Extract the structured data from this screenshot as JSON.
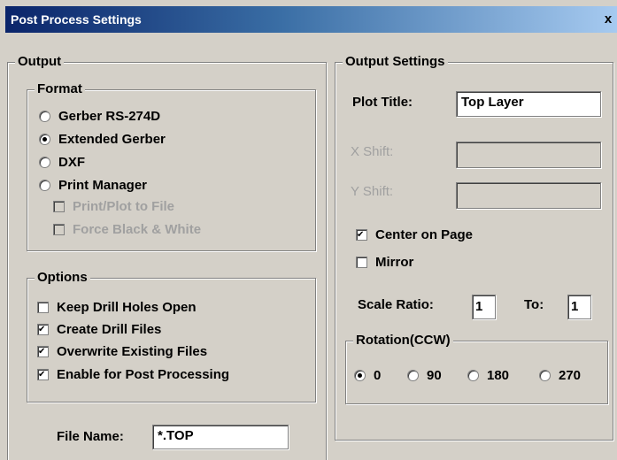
{
  "window": {
    "title": "Post Process Settings",
    "close_glyph": "x"
  },
  "output": {
    "group_label": "Output",
    "format": {
      "group_label": "Format",
      "options": [
        {
          "label": "Gerber RS-274D",
          "checked": false
        },
        {
          "label": "Extended Gerber",
          "checked": true
        },
        {
          "label": "DXF",
          "checked": false
        },
        {
          "label": "Print Manager",
          "checked": false
        }
      ],
      "sub_options": [
        {
          "label": "Print/Plot to File",
          "checked": false,
          "enabled": false
        },
        {
          "label": "Force Black & White",
          "checked": false,
          "enabled": false
        }
      ]
    },
    "options": {
      "group_label": "Options",
      "items": [
        {
          "label": "Keep Drill Holes Open",
          "checked": false
        },
        {
          "label": "Create Drill Files",
          "checked": true
        },
        {
          "label": "Overwrite Existing Files",
          "checked": true
        },
        {
          "label": "Enable for Post Processing",
          "checked": true
        }
      ]
    },
    "file_name": {
      "label": "File Name:",
      "value": "*.TOP"
    }
  },
  "output_settings": {
    "group_label": "Output Settings",
    "plot_title": {
      "label": "Plot Title:",
      "value": "Top Layer"
    },
    "x_shift": {
      "label": "X Shift:",
      "value": ""
    },
    "y_shift": {
      "label": "Y Shift:",
      "value": ""
    },
    "center_on_page": {
      "label": "Center on Page",
      "checked": true
    },
    "mirror": {
      "label": "Mirror",
      "checked": false
    },
    "scale_ratio": {
      "label": "Scale Ratio:",
      "value": "1",
      "to_label": "To:",
      "to_value": "1"
    },
    "rotation": {
      "group_label": "Rotation(CCW)",
      "options": [
        {
          "label": "0",
          "checked": true
        },
        {
          "label": "90",
          "checked": false
        },
        {
          "label": "180",
          "checked": false
        },
        {
          "label": "270",
          "checked": false
        }
      ]
    }
  }
}
